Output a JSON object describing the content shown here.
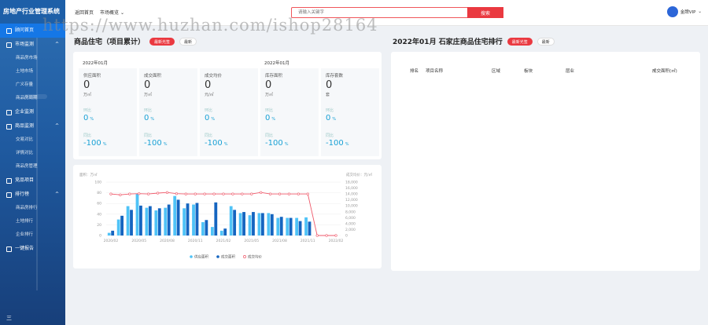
{
  "app_title": "房地产行业管理系统",
  "sidebar": {
    "items": [
      {
        "label": "顾问首页",
        "active": true,
        "chev": ""
      },
      {
        "label": "市场监测",
        "active": false,
        "chev": "^",
        "subs": [
          "商品房市场",
          "土地市场",
          "广义存量",
          "商品房周期"
        ]
      },
      {
        "label": "企业监测",
        "active": false,
        "chev": ""
      },
      {
        "label": "商品监测",
        "active": false,
        "chev": "^",
        "subs": [
          "交易对比",
          "详情对比",
          "商品房管理"
        ]
      },
      {
        "label": "竞品项目",
        "active": false,
        "chev": ""
      },
      {
        "label": "排行榜",
        "active": false,
        "chev": "^",
        "subs": [
          "商品房排行",
          "土地排行",
          "企业排行"
        ]
      },
      {
        "label": "一键报告",
        "active": false,
        "chev": ""
      }
    ],
    "bottom_glyph": "三"
  },
  "topbar": {
    "home_link": "返回首页",
    "market_menu": "市场概览",
    "market_chev": "⌄",
    "search_placeholder": "请输入关键字",
    "search_button": "搜索",
    "user_name": "金牌VIP",
    "user_chev": "⌄"
  },
  "watermark": "https://www.huzhan.com/ishop28164",
  "left_panel": {
    "title": "商品住宅（项目累计）",
    "pill_on": "最新光签",
    "pill_off": "最新",
    "date_left": "2022年01月",
    "date_right": "2022年01月",
    "kpis": [
      {
        "label": "供应面积",
        "value": "0",
        "unit": "万㎡",
        "s1_label": "环比",
        "s1_value": "0",
        "s1_pct": "%",
        "s2_label": "同比",
        "s2_value": "-100",
        "s2_pct": "%"
      },
      {
        "label": "成交面积",
        "value": "0",
        "unit": "万㎡",
        "s1_label": "环比",
        "s1_value": "0",
        "s1_pct": "%",
        "s2_label": "同比",
        "s2_value": "-100",
        "s2_pct": "%"
      },
      {
        "label": "成交均价",
        "value": "0",
        "unit": "元/㎡",
        "s1_label": "环比",
        "s1_value": "0",
        "s1_pct": "%",
        "s2_label": "同比",
        "s2_value": "-100",
        "s2_pct": "%"
      },
      {
        "label": "库存面积",
        "value": "0",
        "unit": "万㎡",
        "s1_label": "环比",
        "s1_value": "0",
        "s1_pct": "%",
        "s2_label": "同比",
        "s2_value": "-100",
        "s2_pct": "%"
      },
      {
        "label": "库存套数",
        "value": "0",
        "unit": "套",
        "s1_label": "环比",
        "s1_value": "0",
        "s1_pct": "%",
        "s2_label": "同比",
        "s2_value": "-100",
        "s2_pct": "%"
      }
    ]
  },
  "right_panel": {
    "title": "2022年01月 石家庄商品住宅排行",
    "pill_on": "最新光签",
    "pill_off": "最新",
    "columns": [
      "排名",
      "项目名称",
      "区域",
      "板块",
      "层业",
      "成交面积(㎡)"
    ],
    "sort_chev": "⌄"
  },
  "chart_data": {
    "type": "bar",
    "ylabel": "面积：万㎡",
    "y2label": "成交均价：元/㎡",
    "ylim": [
      0,
      100
    ],
    "y2lim": [
      0,
      18000
    ],
    "yticks": [
      0,
      20,
      40,
      60,
      80,
      100
    ],
    "y2ticks": [
      "0",
      "2,000",
      "4,000",
      "6,000",
      "8,000",
      "10,000",
      "12,000",
      "14,000",
      "16,000",
      "18,000"
    ],
    "x_tick_labels": [
      "2020/02",
      "2020/05",
      "2020/08",
      "2020/11",
      "2021/02",
      "2021/05",
      "2021/08",
      "2021/11",
      "2022/02"
    ],
    "periods": 25,
    "series": [
      {
        "name": "供应面积",
        "color": "#4fc3f7",
        "values": [
          5,
          30,
          55,
          78,
          52,
          47,
          52,
          74,
          51,
          58,
          25,
          16,
          9,
          55,
          42,
          38,
          42,
          42,
          33,
          33,
          33,
          34,
          0,
          0,
          0
        ]
      },
      {
        "name": "成交面积",
        "color": "#1565c0",
        "values": [
          9,
          37,
          48,
          56,
          55,
          51,
          58,
          67,
          60,
          61,
          29,
          62,
          13,
          48,
          44,
          44,
          42,
          40,
          35,
          33,
          27,
          26,
          0,
          0,
          0
        ]
      },
      {
        "name": "成交均价",
        "color": "#ef5a6b",
        "type": "line",
        "values": [
          14000,
          13700,
          14000,
          14100,
          14000,
          14300,
          14500,
          14100,
          14000,
          14000,
          14000,
          14000,
          14000,
          14000,
          14000,
          14000,
          14500,
          14000,
          14000,
          14000,
          14000,
          14000,
          0,
          0,
          0
        ]
      }
    ]
  }
}
